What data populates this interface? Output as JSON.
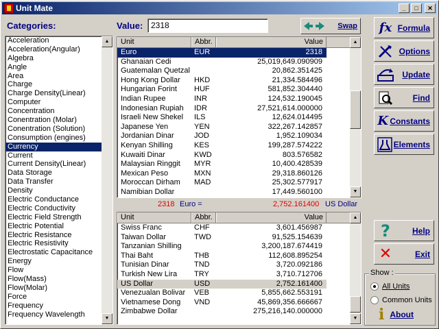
{
  "window": {
    "title": "Unit Mate"
  },
  "labels": {
    "categories": "Categories:",
    "value": "Value:"
  },
  "value_input": "2318",
  "swap_label": "Swap",
  "categories": [
    "Acceleration",
    "Acceleration(Angular)",
    "Algebra",
    "Angle",
    "Area",
    "Charge",
    "Charge Density(Linear)",
    "Computer",
    "Concentration",
    "Conentration (Molar)",
    "Conentration (Solution)",
    "Consumption (engines)",
    "Currency",
    "Current",
    "Current Density(Linear)",
    "Data Storage",
    "Data Transfer",
    "Density",
    "Electric Conductance",
    "Electric Conductivity",
    "Electric Field Strength",
    "Electric Potential",
    "Electric Resistance",
    "Electric Resistivity",
    "Electrostatic Capacitance",
    "Energy",
    "Flow",
    "Flow(Mass)",
    "Flow(Molar)",
    "Force",
    "Frequency",
    "Frequency Wavelength"
  ],
  "selected_category": "Currency",
  "grid_headers": {
    "unit": "Unit",
    "abbr": "Abbr.",
    "value": "Value"
  },
  "top_grid": [
    {
      "unit": "Euro",
      "abbr": "EUR",
      "value": "2318",
      "sel": true
    },
    {
      "unit": "Ghanaian Cedi",
      "abbr": "",
      "value": "25,019,649.090909"
    },
    {
      "unit": "Guatemalan Quetzal",
      "abbr": "",
      "value": "20,862.351425"
    },
    {
      "unit": "Hong Kong Dollar",
      "abbr": "HKD",
      "value": "21,334.584496"
    },
    {
      "unit": "Hungarian Forint",
      "abbr": "HUF",
      "value": "581,852.304440"
    },
    {
      "unit": "Indian Rupee",
      "abbr": "INR",
      "value": "124,532.190045"
    },
    {
      "unit": "Indonesian Rupiah",
      "abbr": "IDR",
      "value": "27,521,614.000000"
    },
    {
      "unit": "Israeli New Shekel",
      "abbr": "ILS",
      "value": "12,624.014495"
    },
    {
      "unit": "Japanese Yen",
      "abbr": "YEN",
      "value": "322,267.142857"
    },
    {
      "unit": "Jordanian Dinar",
      "abbr": "JOD",
      "value": "1,952.109034"
    },
    {
      "unit": "Kenyan Shilling",
      "abbr": "KES",
      "value": "199,287.574222"
    },
    {
      "unit": "Kuwaiti Dinar",
      "abbr": "KWD",
      "value": "803.576582"
    },
    {
      "unit": "Malaysian Ringgit",
      "abbr": "MYR",
      "value": "10,400.428539"
    },
    {
      "unit": "Mexican Peso",
      "abbr": "MXN",
      "value": "29,318.860126"
    },
    {
      "unit": "Moroccan Dirham",
      "abbr": "MAD",
      "value": "25,302.577917"
    },
    {
      "unit": "Namibian Dollar",
      "abbr": "",
      "value": "17,449.560100"
    }
  ],
  "result": {
    "left_value": "2318",
    "left_unit": "Euro =",
    "right_value": "2,752.161400",
    "right_unit": "US Dollar"
  },
  "bottom_grid": [
    {
      "unit": "Swiss Franc",
      "abbr": "CHF",
      "value": "3,601.456987"
    },
    {
      "unit": "Taiwan Dollar",
      "abbr": "TWD",
      "value": "91,525.154639"
    },
    {
      "unit": "Tanzanian Shilling",
      "abbr": "",
      "value": "3,200,187.674419"
    },
    {
      "unit": "Thai Baht",
      "abbr": "THB",
      "value": "112,608.895254"
    },
    {
      "unit": "Tunisian Dinar",
      "abbr": "TND",
      "value": "3,720.092186"
    },
    {
      "unit": "Turkish New Lira",
      "abbr": "TRY",
      "value": "3,710.712706"
    },
    {
      "unit": "US Dollar",
      "abbr": "USD",
      "value": "2,752.161400",
      "hi": true
    },
    {
      "unit": "Venezualan Bolivar",
      "abbr": "VEB",
      "value": "5,855,662.553191"
    },
    {
      "unit": "Vietnamese Dong",
      "abbr": "VND",
      "value": "45,869,356.666667"
    },
    {
      "unit": "Zimbabwe Dollar",
      "abbr": "",
      "value": "275,216,140.000000"
    }
  ],
  "side_buttons": {
    "formula": "Formula",
    "options": "Options",
    "update": "Update",
    "find": "Find",
    "constants": "Constants",
    "elements": "Elements",
    "help": "Help",
    "exit": "Exit",
    "about": "About"
  },
  "show_group": {
    "legend": "Show :",
    "all_units": "All Units",
    "common_units": "Common Units"
  }
}
